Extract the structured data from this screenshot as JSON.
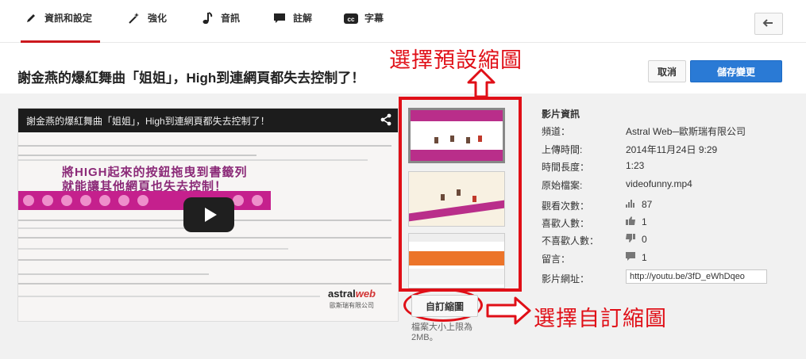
{
  "tabs": [
    {
      "label": "資訊和設定",
      "icon": "pencil-icon",
      "active": true
    },
    {
      "label": "強化",
      "icon": "magic-wand-icon"
    },
    {
      "label": "音訊",
      "icon": "music-note-icon"
    },
    {
      "label": "註解",
      "icon": "speech-bubble-icon"
    },
    {
      "label": "字幕",
      "icon": "cc-icon"
    }
  ],
  "header": {
    "video_title": "謝金燕的爆紅舞曲「姐姐」，High到連網頁都失去控制了！",
    "cancel_label": "取消",
    "save_label": "儲存變更"
  },
  "player": {
    "title": "謝金燕的爆紅舞曲「姐姐」，High到連網頁都失去控制了！",
    "overlay_line1": "將HIGH起來的按鈕拖曳到書籤列",
    "overlay_line2": "就能讓其他網頁也失去控制！",
    "logo_main": "astral",
    "logo_accent": "web",
    "logo_sub": "歐斯瑞有限公司"
  },
  "thumbnails": {
    "custom_button": "自訂縮圖",
    "size_note": "檔案大小上限為 2MB。"
  },
  "annotations": {
    "top": "選擇預設縮圖",
    "right": "選擇自訂縮圖"
  },
  "info": {
    "heading": "影片資訊",
    "rows": [
      {
        "label": "頻道：",
        "value": "Astral Web─歐斯瑞有限公司"
      },
      {
        "label": "上傳時間:",
        "value": "2014年11月24日 9:29"
      },
      {
        "label": "時間長度：",
        "value": "1:23"
      },
      {
        "label": "原始檔案:",
        "value": "videofunny.mp4"
      },
      {
        "label": "觀看次數：",
        "value": "87",
        "icon": "bar-chart-icon"
      },
      {
        "label": "喜歡人數：",
        "value": "1",
        "icon": "thumbs-up-icon"
      },
      {
        "label": "不喜歡人數：",
        "value": "0",
        "icon": "thumbs-down-icon"
      },
      {
        "label": "留言：",
        "value": "1",
        "icon": "comment-icon"
      }
    ],
    "url_label": "影片網址：",
    "url_value": "http://youtu.be/3fD_eWhDqeo"
  },
  "colors": {
    "accent_red": "#cc181e",
    "annotation_red": "#e00f17",
    "save_blue": "#2a7ad5"
  }
}
